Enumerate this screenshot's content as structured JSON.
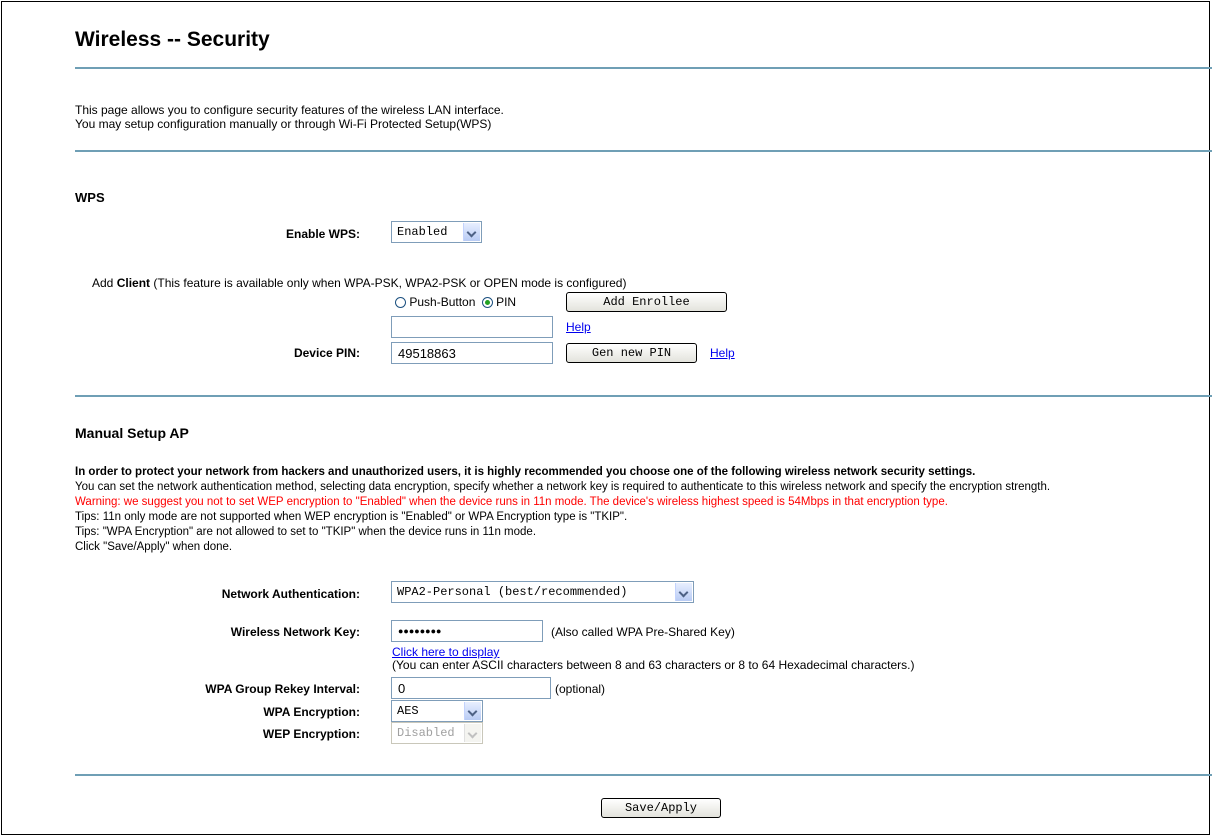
{
  "page": {
    "title": "Wireless -- Security",
    "intro_line1": "This page allows you to configure security features of the wireless LAN interface.",
    "intro_line2": "You may setup configuration manually or through Wi-Fi Protected Setup(WPS)"
  },
  "wps": {
    "heading": "WPS",
    "enable_label": "Enable WPS:",
    "enable_value": "Enabled",
    "add_client_label": "Add",
    "add_client_bold": "Client",
    "add_client_note": "(This feature is available only when WPA-PSK, WPA2-PSK or OPEN mode is configured)",
    "push_button_label": "Push-Button",
    "pin_label": "PIN",
    "selected_mode": "PIN",
    "add_enrollee_button": "Add Enrollee",
    "enrollee_pin_value": "",
    "help_link": "Help",
    "device_pin_label": "Device PIN:",
    "device_pin_value": "49518863",
    "gen_pin_button": "Gen new PIN",
    "device_help_link": "Help"
  },
  "manual": {
    "heading": "Manual Setup AP",
    "bold_line": "In order to protect your network from hackers and unauthorized users, it is highly recommended you choose one of the following wireless network security settings.",
    "line2": "You can set the network authentication method, selecting data encryption, specify whether a network key is required to authenticate to this wireless network and specify the encryption strength.",
    "warning": "Warning: we suggest you not to set WEP encryption to \"Enabled\" when the device runs in 11n mode. The device's wireless highest speed is 54Mbps in that encryption type.",
    "tip1": "Tips: 11n only mode are not supported when WEP encryption is \"Enabled\" or WPA Encryption type is \"TKIP\".",
    "tip2": "Tips: \"WPA Encryption\" are not allowed to set to \"TKIP\" when the device runs in 11n mode.",
    "tip3": "Click \"Save/Apply\" when done.",
    "auth_label": "Network Authentication:",
    "auth_value": "WPA2-Personal (best/recommended)",
    "key_label": "Wireless Network Key:",
    "key_value": "●●●●●●●●",
    "key_note": "(Also called WPA Pre-Shared Key)",
    "display_link": "Click here to display",
    "key_hint": "(You can enter ASCII characters between 8 and 63 characters or 8 to 64 Hexadecimal characters.)",
    "rekey_label": "WPA Group Rekey Interval:",
    "rekey_value": "0",
    "rekey_note": "(optional)",
    "wpa_enc_label": "WPA Encryption:",
    "wpa_enc_value": "AES",
    "wep_enc_label": "WEP Encryption:",
    "wep_enc_value": "Disabled"
  },
  "footer": {
    "save_button": "Save/Apply"
  }
}
